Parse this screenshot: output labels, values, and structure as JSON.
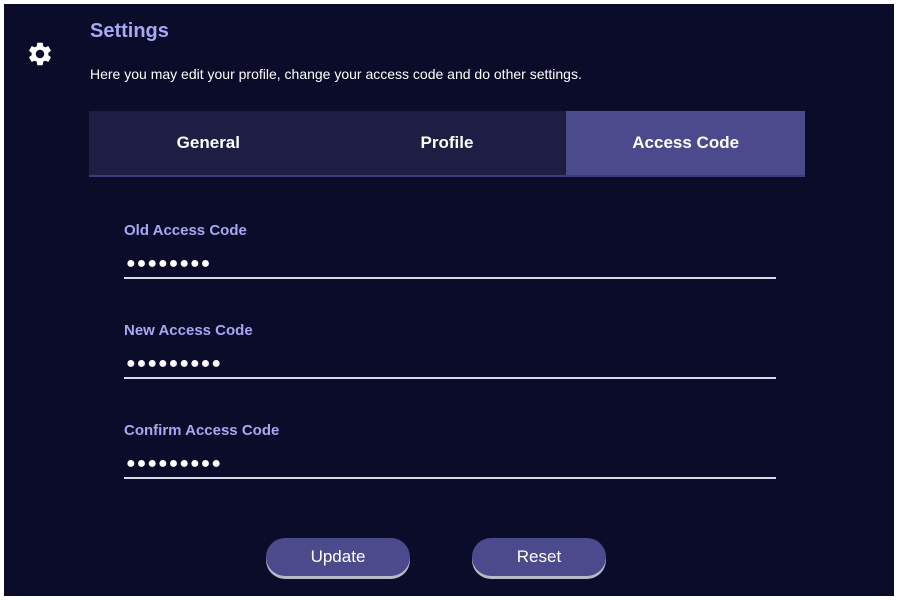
{
  "header": {
    "title": "Settings",
    "description": "Here you may edit your profile, change your access code and do other settings.",
    "icon": "gear-icon"
  },
  "tabs": [
    {
      "label": "General",
      "active": false
    },
    {
      "label": "Profile",
      "active": false
    },
    {
      "label": "Access Code",
      "active": true
    }
  ],
  "form": {
    "old_code": {
      "label": "Old Access Code",
      "value": "●●●●●●●●"
    },
    "new_code": {
      "label": "New Access Code",
      "value": "●●●●●●●●●"
    },
    "confirm_code": {
      "label": "Confirm Access Code",
      "value": "●●●●●●●●●"
    }
  },
  "buttons": {
    "update": "Update",
    "reset": "Reset"
  },
  "colors": {
    "background": "#0b0b2a",
    "accent": "#4a4a8c",
    "label": "#a7a8f3",
    "tab_bar": "#1e1e45"
  }
}
